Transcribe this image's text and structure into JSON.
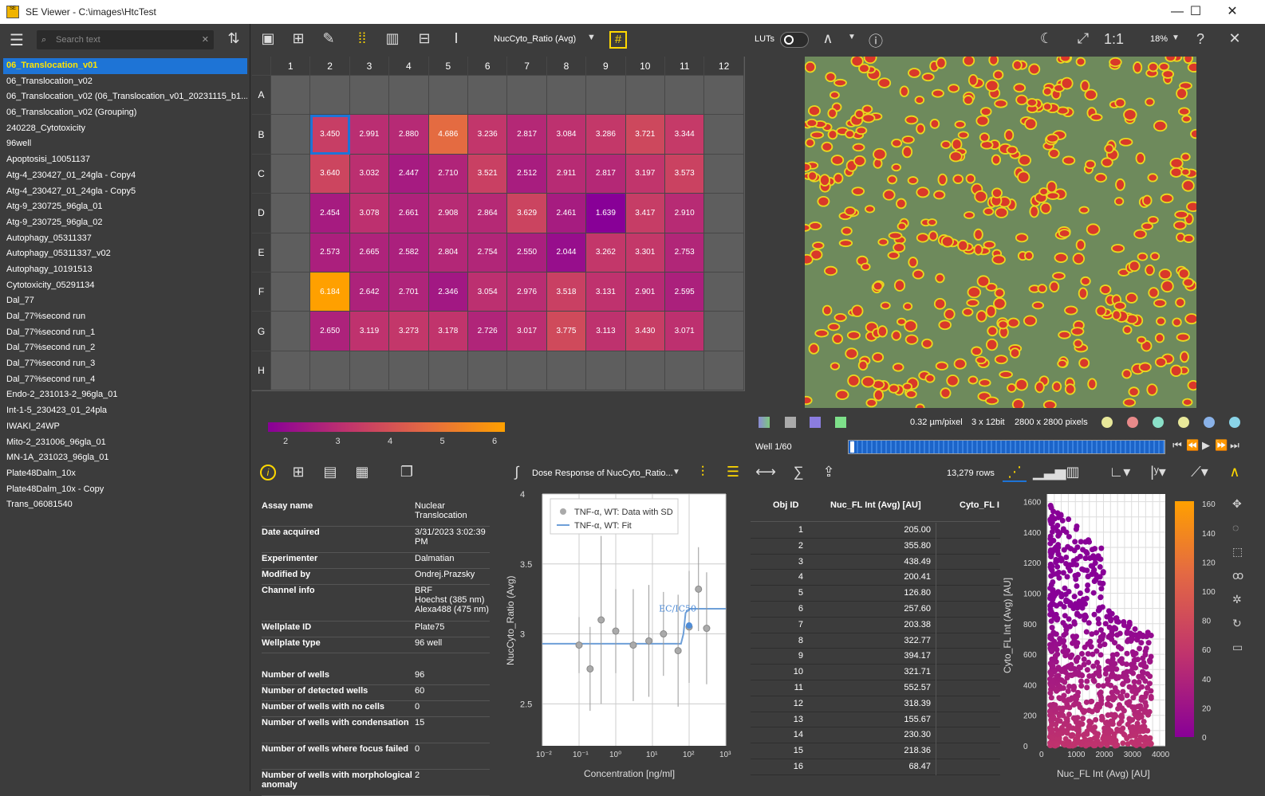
{
  "window": {
    "title": "SE Viewer - C:\\images\\HtcTest",
    "minimize": "—",
    "maximize": "☐",
    "close": "✕"
  },
  "search": {
    "placeholder": "Search text"
  },
  "experiments": [
    "06_Translocation_v01",
    "06_Translocation_v02",
    "06_Translocation_v02 (06_Translocation_v01_20231115_b1...",
    "06_Translocation_v02 (Grouping)",
    "240228_Cytotoxicity",
    "96well",
    "Apoptosisi_10051137",
    "Atg-4_230427_01_24gla - Copy4",
    "Atg-4_230427_01_24gla - Copy5",
    "Atg-9_230725_96gla_01",
    "Atg-9_230725_96gla_02",
    "Autophagy_05311337",
    "Autophagy_05311337_v02",
    "Autophagy_10191513",
    "Cytotoxicity_05291134",
    "Dal_77",
    "Dal_77%second run",
    "Dal_77%second run_1",
    "Dal_77%second run_2",
    "Dal_77%second run_3",
    "Dal_77%second run_4",
    "Endo-2_231013-2_96gla_01",
    "Int-1-5_230423_01_24pla",
    "IWAKI_24WP",
    "Mito-2_231006_96gla_01",
    "MN-1A_231023_96gla_01",
    "Plate48Dalm_10x",
    "Plate48Dalm_10x - Copy",
    "Trans_06081540"
  ],
  "plate": {
    "measure": "NucCyto_Ratio (Avg)",
    "cols": [
      "1",
      "2",
      "3",
      "4",
      "5",
      "6",
      "7",
      "8",
      "9",
      "10",
      "11",
      "12"
    ],
    "rows": [
      "A",
      "B",
      "C",
      "D",
      "E",
      "F",
      "G",
      "H"
    ],
    "values": {
      "B": [
        "",
        "3.450",
        "2.991",
        "2.880",
        "4.686",
        "3.236",
        "2.817",
        "3.084",
        "3.286",
        "3.721",
        "3.344",
        ""
      ],
      "C": [
        "",
        "3.640",
        "3.032",
        "2.447",
        "2.710",
        "3.521",
        "2.512",
        "2.911",
        "2.817",
        "3.197",
        "3.573",
        ""
      ],
      "D": [
        "",
        "2.454",
        "3.078",
        "2.661",
        "2.908",
        "2.864",
        "3.629",
        "2.461",
        "1.639",
        "3.417",
        "2.910",
        ""
      ],
      "E": [
        "",
        "2.573",
        "2.665",
        "2.582",
        "2.804",
        "2.754",
        "2.550",
        "2.044",
        "3.262",
        "3.301",
        "2.753",
        ""
      ],
      "F": [
        "",
        "6.184",
        "2.642",
        "2.701",
        "2.346",
        "3.054",
        "2.976",
        "3.518",
        "3.131",
        "2.901",
        "2.595",
        ""
      ],
      "G": [
        "",
        "2.650",
        "3.119",
        "3.273",
        "3.178",
        "2.726",
        "3.017",
        "3.775",
        "3.113",
        "3.430",
        "3.071",
        ""
      ]
    },
    "selected": "B2",
    "colorbar_ticks": [
      "2",
      "3",
      "4",
      "5",
      "6"
    ]
  },
  "viewer": {
    "luts": "LUTs",
    "zoom_ratio": "1:1",
    "zoom": "18%",
    "help": "?",
    "pixel_size": "0.32 µm/pixel",
    "bitdepth": "3 x 12bit",
    "dimensions": "2800 x 2800 pixels",
    "well_label": "Well 1/60",
    "well_position": 0.0
  },
  "info": [
    [
      "Assay name",
      "Nuclear Translocation"
    ],
    [
      "Date acquired",
      "3/31/2023 3:02:39 PM"
    ],
    [
      "Experimenter",
      "Dalmatian"
    ],
    [
      "Modified by",
      "Ondrej.Prazsky"
    ],
    [
      "Channel info",
      "BRF\nHoechst (385 nm)\nAlexa488 (475 nm)"
    ],
    [
      "Wellplate ID",
      "Plate75"
    ],
    [
      "Wellplate type",
      "96 well"
    ],
    [
      "Number of wells",
      "96"
    ],
    [
      "Number of detected wells",
      "60"
    ],
    [
      "Number of wells with no cells",
      "0"
    ],
    [
      "Number of wells with condensation",
      "15"
    ],
    [
      "Number of wells where focus failed",
      "0"
    ],
    [
      "Number of wells with morphological anomaly",
      "2"
    ]
  ],
  "dose": {
    "dropdown": "Dose Response of NucCyto_Ratio...",
    "legend_data": "TNF-α, WT: Data with SD",
    "legend_fit": "TNF-α, WT: Fit",
    "annot": "EC/IC50",
    "xlabel": "Concentration [ng/ml]",
    "ylabel": "NucCyto_Ratio (Avg)"
  },
  "table": {
    "rows_count": "13,279 rows",
    "headers": [
      "Obj ID",
      "Nuc_FL Int (Avg) [AU]",
      "Cyto_FL I"
    ],
    "rows": [
      [
        "1",
        "205.00"
      ],
      [
        "2",
        "355.80"
      ],
      [
        "3",
        "438.49"
      ],
      [
        "4",
        "200.41"
      ],
      [
        "5",
        "126.80"
      ],
      [
        "6",
        "257.60"
      ],
      [
        "7",
        "203.38"
      ],
      [
        "8",
        "322.77"
      ],
      [
        "9",
        "394.17"
      ],
      [
        "10",
        "321.71"
      ],
      [
        "11",
        "552.57"
      ],
      [
        "12",
        "318.39"
      ],
      [
        "13",
        "155.67"
      ],
      [
        "14",
        "230.30"
      ],
      [
        "15",
        "218.36"
      ],
      [
        "16",
        "68.47"
      ]
    ]
  },
  "chart_data": [
    {
      "type": "scatter",
      "title": "",
      "xlabel": "Concentration [ng/ml]",
      "ylabel": "NucCyto_Ratio (Avg)",
      "x_scale": "log",
      "xlim": [
        0.01,
        1000
      ],
      "ylim": [
        2.2,
        4
      ],
      "xticks": [
        "10⁻²",
        "10⁻¹",
        "10⁰",
        "10¹",
        "10²",
        "10³"
      ],
      "yticks": [
        "2.5",
        "3",
        "3.5",
        "4"
      ],
      "series": [
        {
          "name": "TNF-α, WT: Data with SD",
          "x": [
            0.1,
            0.2,
            0.4,
            1,
            3,
            8,
            20,
            50,
            100,
            180,
            300
          ],
          "y": [
            2.92,
            2.75,
            3.1,
            3.02,
            2.92,
            2.95,
            3.0,
            2.88,
            3.05,
            3.32,
            3.04
          ],
          "sd": [
            0.2,
            0.3,
            0.6,
            0.3,
            0.4,
            0.4,
            0.3,
            0.4,
            0.4,
            0.3,
            0.4
          ]
        },
        {
          "name": "TNF-α, WT: Fit",
          "x": [
            0.01,
            60,
            70,
            80,
            100,
            1000
          ],
          "y": [
            2.93,
            2.93,
            3.0,
            3.15,
            3.18,
            3.18
          ]
        }
      ],
      "legend": "top-left",
      "grid": true
    },
    {
      "type": "scatter",
      "title": "",
      "xlabel": "Nuc_FL Int (Avg) [AU]",
      "ylabel": "Cyto_FL Int (Avg) [AU]",
      "xlim": [
        0,
        4200
      ],
      "ylim": [
        0,
        1650
      ],
      "xticks": [
        "0",
        "1000",
        "2000",
        "3000",
        "4000"
      ],
      "yticks": [
        "0",
        "200",
        "400",
        "600",
        "800",
        "1000",
        "1200",
        "1400",
        "1600"
      ],
      "colorbar_ticks": [
        "0",
        "20",
        "40",
        "60",
        "80",
        "100",
        "120",
        "140",
        "160"
      ],
      "grid": true
    }
  ]
}
